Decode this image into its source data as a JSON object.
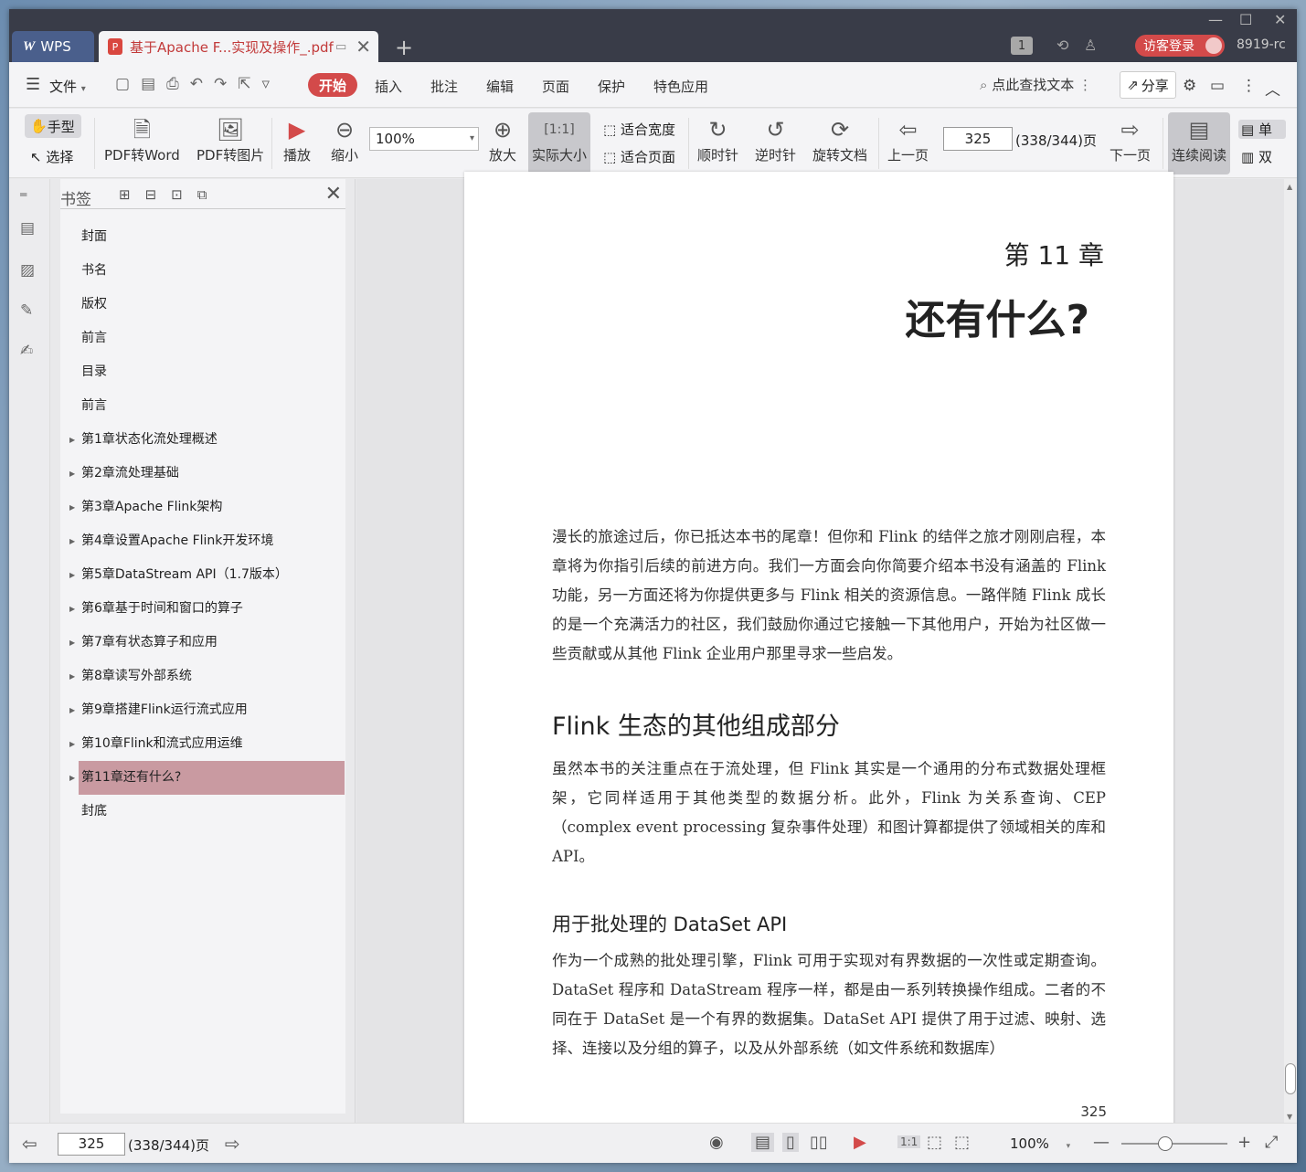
{
  "titlebar": {
    "app_tab": "WPS",
    "doc_tab": "基于Apache F...实现及操作_.pdf",
    "badge_count": "1",
    "login_label": "访客登录",
    "user_id": "8919-rc"
  },
  "menubar": {
    "file_label": "文件",
    "items": [
      "开始",
      "插入",
      "批注",
      "编辑",
      "页面",
      "保护",
      "特色应用"
    ],
    "search_label": "点此查找文本",
    "share_label": "分享"
  },
  "toolbar": {
    "hand": "手型",
    "select": "选择",
    "pdf_to_word": "PDF转Word",
    "pdf_to_image": "PDF转图片",
    "play": "播放",
    "zoom_out": "缩小",
    "zoom_value": "100%",
    "zoom_in": "放大",
    "actual_size": "实际大小",
    "fit_width": "适合宽度",
    "fit_page": "适合页面",
    "clockwise": "顺时针",
    "counter_clockwise": "逆时针",
    "rotate_doc": "旋转文档",
    "prev_page": "上一页",
    "page_input": "325",
    "page_total": "(338/344)页",
    "next_page": "下一页",
    "continuous": "连续阅读",
    "single": "单",
    "double": "双"
  },
  "bookmarks": {
    "title": "书签",
    "items": [
      {
        "label": "封面",
        "expandable": false
      },
      {
        "label": "书名",
        "expandable": false
      },
      {
        "label": "版权",
        "expandable": false
      },
      {
        "label": "前言",
        "expandable": false
      },
      {
        "label": "目录",
        "expandable": false
      },
      {
        "label": "前言",
        "expandable": false
      },
      {
        "label": "第1章状态化流处理概述",
        "expandable": true
      },
      {
        "label": "第2章流处理基础",
        "expandable": true
      },
      {
        "label": "第3章Apache Flink架构",
        "expandable": true
      },
      {
        "label": "第4章设置Apache Flink开发环境",
        "expandable": true
      },
      {
        "label": "第5章DataStream API（1.7版本）",
        "expandable": true
      },
      {
        "label": "第6章基于时间和窗口的算子",
        "expandable": true
      },
      {
        "label": "第7章有状态算子和应用",
        "expandable": true
      },
      {
        "label": "第8章读写外部系统",
        "expandable": true
      },
      {
        "label": "第9章搭建Flink运行流式应用",
        "expandable": true
      },
      {
        "label": "第10章Flink和流式应用运维",
        "expandable": true
      },
      {
        "label": "第11章还有什么?",
        "expandable": true,
        "selected": true
      },
      {
        "label": "封底",
        "expandable": false
      }
    ]
  },
  "page": {
    "chapter_number": "第 11 章",
    "chapter_title": "还有什么?",
    "intro": "漫长的旅途过后，你已抵达本书的尾章！但你和 Flink 的结伴之旅才刚刚启程，本章将为你指引后续的前进方向。我们一方面会向你简要介绍本书没有涵盖的 Flink 功能，另一方面还将为你提供更多与 Flink 相关的资源信息。一路伴随 Flink 成长的是一个充满活力的社区，我们鼓励你通过它接触一下其他用户，开始为社区做一些贡献或从其他 Flink 企业用户那里寻求一些启发。",
    "h2": "Flink 生态的其他组成部分",
    "para2": "虽然本书的关注重点在于流处理，但 Flink 其实是一个通用的分布式数据处理框架，它同样适用于其他类型的数据分析。此外，Flink 为关系查询、CEP（complex event processing 复杂事件处理）和图计算都提供了领域相关的库和 API。",
    "h3": "用于批处理的 DataSet API",
    "para3": "作为一个成熟的批处理引擎，Flink 可用于实现对有界数据的一次性或定期查询。DataSet 程序和 DataStream 程序一样，都是由一系列转换操作组成。二者的不同在于 DataSet 是一个有界的数据集。DataSet API 提供了用于过滤、映射、选择、连接以及分组的算子，以及从外部系统（如文件系统和数据库）",
    "page_number": "325"
  },
  "statusbar": {
    "page_input": "325",
    "page_total": "(338/344)页",
    "zoom": "100%",
    "zoom_fraction": 0.4
  }
}
